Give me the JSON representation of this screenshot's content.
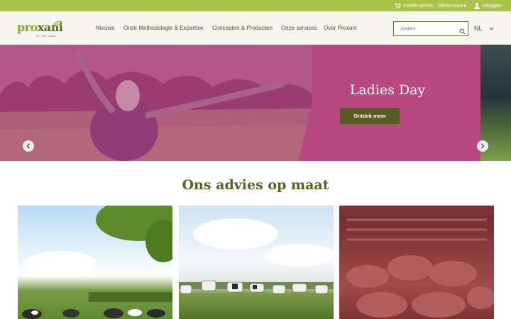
{
  "topbar": {
    "feedexpress": "FeedExpress",
    "silosensoren": "Silosensoren",
    "inloggen": "Inloggen"
  },
  "logo": {
    "part1": "pro",
    "part2": "xani",
    "tagline": "life · feed · quality"
  },
  "nav": {
    "items": [
      "Nieuws",
      "Onze Methodologie & Expertise",
      "Concepten & Producten",
      "Onze services",
      "Over Proxani"
    ]
  },
  "search": {
    "placeholder": "zoeken"
  },
  "language": {
    "current": "NL"
  },
  "hero": {
    "title": "Ladies Day",
    "cta": "Ontdek meer",
    "slide_count": 7,
    "active_slide": 2
  },
  "section": {
    "title": "Ons advies op maat"
  },
  "colors": {
    "topbar": "#a8c24a",
    "hero_pink": "#b84880",
    "cta": "#5a5a24",
    "heading": "#5b6222"
  }
}
